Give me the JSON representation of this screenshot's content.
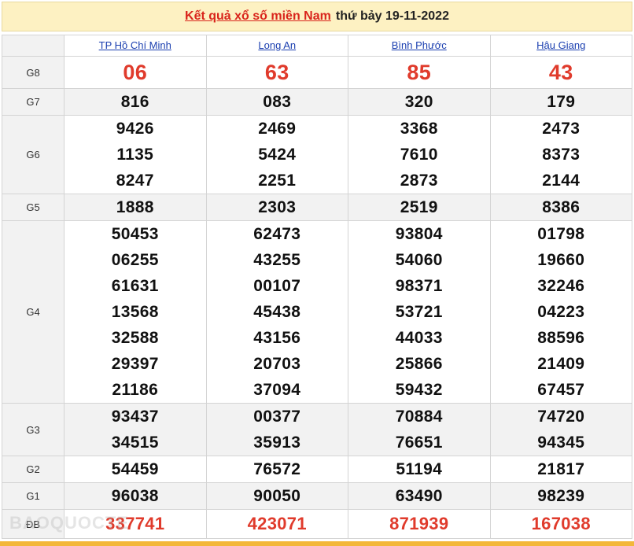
{
  "header": {
    "title_link": "Kết quả xổ số miền Nam",
    "title_date": "thứ bảy 19-11-2022"
  },
  "provinces": [
    "TP Hồ Chí Minh",
    "Long An",
    "Bình Phước",
    "Hậu Giang"
  ],
  "prizes": [
    {
      "label": "G8",
      "values": [
        [
          "06"
        ],
        [
          "63"
        ],
        [
          "85"
        ],
        [
          "43"
        ]
      ]
    },
    {
      "label": "G7",
      "values": [
        [
          "816"
        ],
        [
          "083"
        ],
        [
          "320"
        ],
        [
          "179"
        ]
      ]
    },
    {
      "label": "G6",
      "values": [
        [
          "9426",
          "1135",
          "8247"
        ],
        [
          "2469",
          "5424",
          "2251"
        ],
        [
          "3368",
          "7610",
          "2873"
        ],
        [
          "2473",
          "8373",
          "2144"
        ]
      ]
    },
    {
      "label": "G5",
      "values": [
        [
          "1888"
        ],
        [
          "2303"
        ],
        [
          "2519"
        ],
        [
          "8386"
        ]
      ]
    },
    {
      "label": "G4",
      "values": [
        [
          "50453",
          "06255",
          "61631",
          "13568",
          "32588",
          "29397",
          "21186"
        ],
        [
          "62473",
          "43255",
          "00107",
          "45438",
          "43156",
          "20703",
          "37094"
        ],
        [
          "93804",
          "54060",
          "98371",
          "53721",
          "44033",
          "25866",
          "59432"
        ],
        [
          "01798",
          "19660",
          "32246",
          "04223",
          "88596",
          "21409",
          "67457"
        ]
      ]
    },
    {
      "label": "G3",
      "values": [
        [
          "93437",
          "34515"
        ],
        [
          "00377",
          "35913"
        ],
        [
          "70884",
          "76651"
        ],
        [
          "74720",
          "94345"
        ]
      ]
    },
    {
      "label": "G2",
      "values": [
        [
          "54459"
        ],
        [
          "76572"
        ],
        [
          "51194"
        ],
        [
          "21817"
        ]
      ]
    },
    {
      "label": "G1",
      "values": [
        [
          "96038"
        ],
        [
          "90050"
        ],
        [
          "63490"
        ],
        [
          "98239"
        ]
      ]
    },
    {
      "label": "ĐB",
      "values": [
        [
          "337741"
        ],
        [
          "423071"
        ],
        [
          "871939"
        ],
        [
          "167038"
        ]
      ]
    }
  ],
  "watermark": "BAOQUOCTE",
  "colors": {
    "red": "#e03b2c",
    "link_blue": "#1b3fb0",
    "title_bg": "#fdf1c2"
  }
}
